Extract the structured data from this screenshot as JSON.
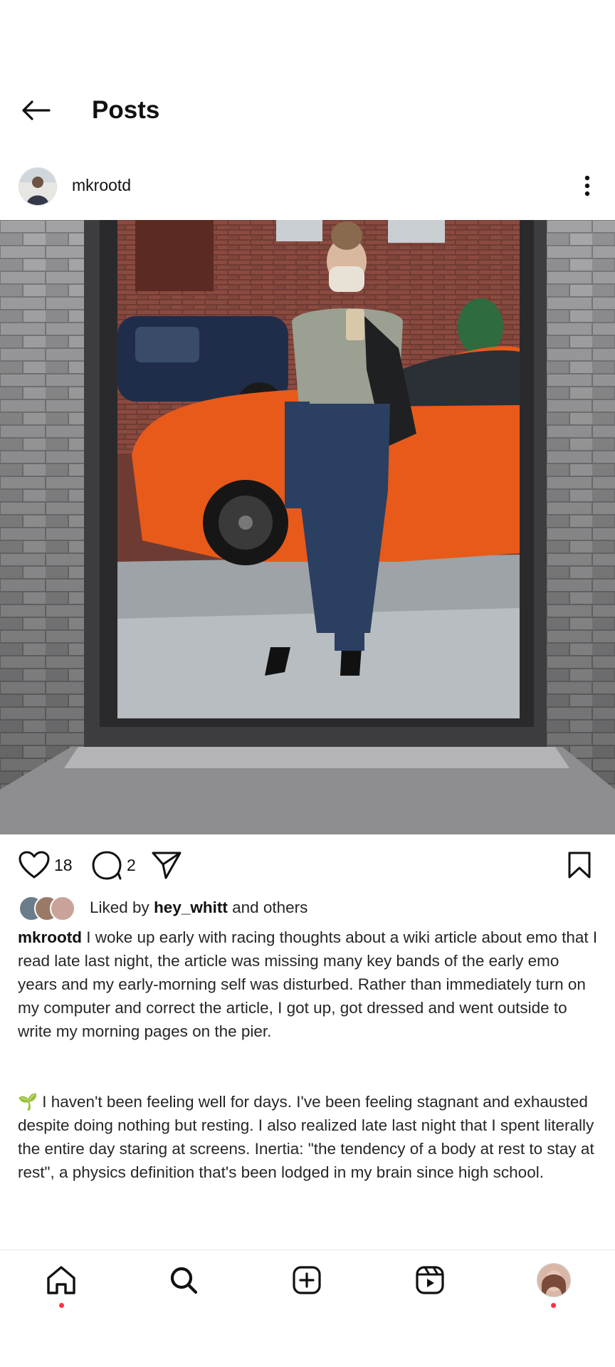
{
  "header": {
    "title": "Posts"
  },
  "post": {
    "username": "mkrootd",
    "likes_count": "18",
    "comments_count": "2",
    "liked_by_prefix": "Liked by ",
    "liked_by_user": "hey_whitt",
    "liked_by_suffix": " and others",
    "caption_username": "mkrootd",
    "caption_p1": " I woke up early with racing thoughts about a wiki article about emo that I read late last night, the article was missing many key bands of the early emo years and my early-morning self was disturbed. Rather than immediately turn on my computer and correct the article, I got up, got dressed and went outside to write my morning pages on the pier.",
    "caption_emoji": "🌱",
    "caption_p2": " I haven't been feeling well for days. I've been feeling stagnant and exhausted despite doing nothing but resting. I also realized late last night that I spent literally the entire day staring at screens. Inertia: \"the tendency of a body at rest to stay at rest\", a physics definition that's been lodged in my brain since high school."
  },
  "nav": {
    "items": [
      "home-icon",
      "search-icon",
      "create-icon",
      "reels-icon",
      "profile-avatar"
    ],
    "active": "home",
    "notification_color": "#ff3040"
  },
  "colors": {
    "text": "#262626",
    "background": "#ffffff"
  }
}
